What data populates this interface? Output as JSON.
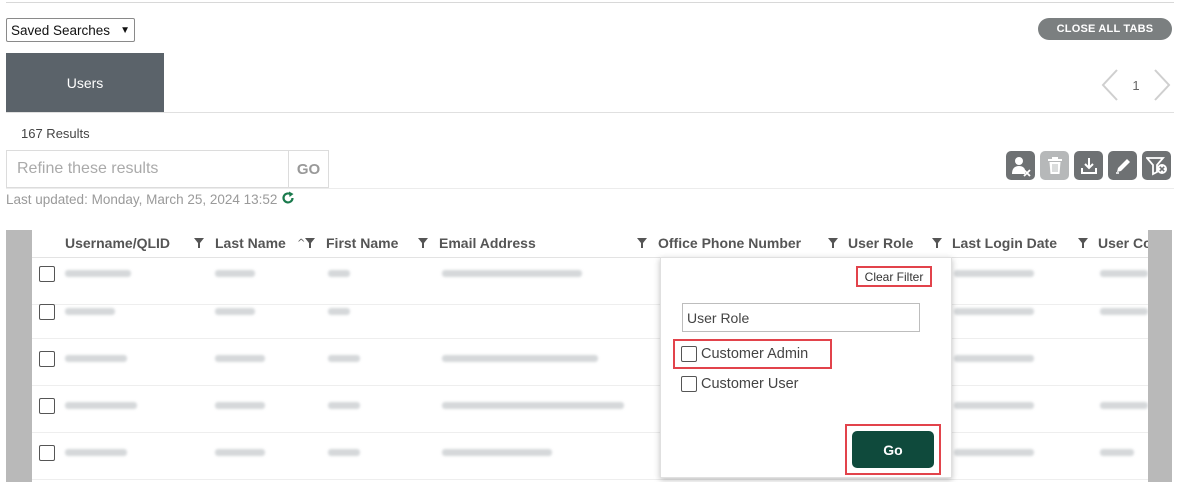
{
  "toolbar_top": {
    "saved_searches": "Saved Searches",
    "close_all_tabs": "CLOSE ALL TABS"
  },
  "tabs": [
    {
      "label": "Users"
    }
  ],
  "pager": {
    "page": "1"
  },
  "results": {
    "count_text": "167 Results"
  },
  "refine": {
    "placeholder": "Refine these results",
    "go_label": "GO"
  },
  "last_updated": "Last updated: Monday, March 25, 2024 13:52",
  "actions": {
    "icons": [
      "remove-user-icon",
      "trash-icon",
      "download-icon",
      "edit-pencil-icon",
      "clear-filter-icon"
    ]
  },
  "table": {
    "columns": [
      {
        "label": "Username/QLID"
      },
      {
        "label": "Last Name"
      },
      {
        "label": "First Name"
      },
      {
        "label": "Email Address"
      },
      {
        "label": "Office Phone Number"
      },
      {
        "label": "User Role"
      },
      {
        "label": "Last Login Date"
      },
      {
        "label": "User Co"
      }
    ]
  },
  "filter_popup": {
    "clear_filter": "Clear Filter",
    "search_value": "User Role",
    "options": [
      {
        "label": "Customer Admin",
        "checked": false
      },
      {
        "label": "Customer User",
        "checked": false
      }
    ],
    "go_label": "Go"
  },
  "colors": {
    "tab_bg": "#5b636a",
    "go_button": "#0f4a3c",
    "highlight": "#e2434b",
    "refresh_icon": "#1a7a4c"
  }
}
